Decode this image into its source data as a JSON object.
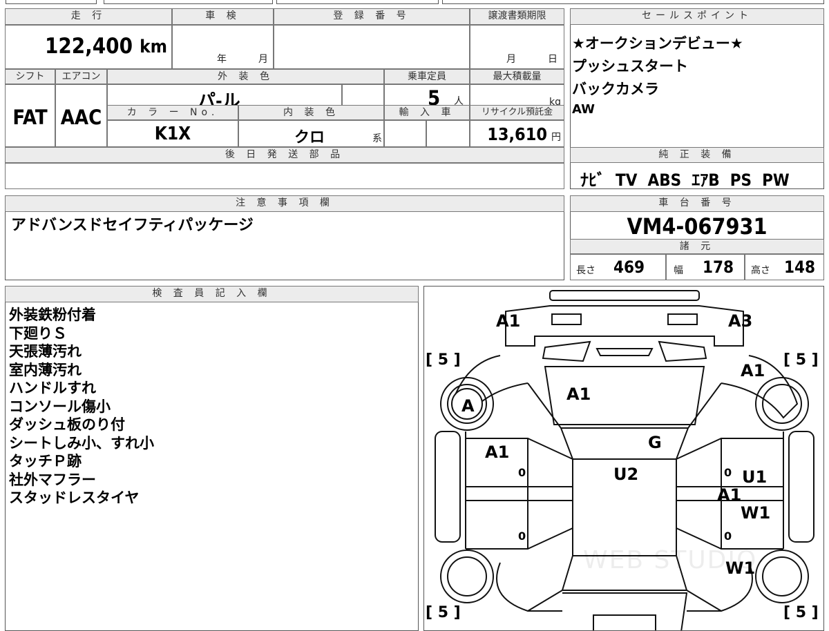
{
  "top_strip": [
    "",
    "",
    "",
    ""
  ],
  "headers": {
    "mileage": "走 行",
    "inspection": "車 検",
    "registration": "登 録 番 号",
    "transfer_deadline": "譲渡書類期限",
    "sales_points": "セールスポイント",
    "shift": "シフト",
    "aircon": "エアコン",
    "exterior_color": "外 装 色",
    "capacity": "乗車定員",
    "max_load": "最大積載量",
    "color_no": "カ ラ ー No.",
    "interior_color": "内 装 色",
    "import": "輸 入 車",
    "recycle": "リサイクル預託金",
    "later_parts": "後 日 発 送 部 品",
    "genuine_equipment": "純 正 装 備",
    "notes": "注 意 事 項 欄",
    "chassis_no": "車 台 番 号",
    "specs": "諸 元",
    "inspector": "検 査 員 記 入 欄"
  },
  "values": {
    "mileage": "122,400",
    "mileage_unit": "km",
    "inspection_year": "年",
    "inspection_month": "月",
    "transfer_month": "月",
    "transfer_day": "日",
    "shift": "FAT",
    "aircon": "AAC",
    "exterior_color": "パ-ル",
    "capacity": "5",
    "capacity_unit": "人",
    "max_load_unit": "kg",
    "color_no": "K1X",
    "interior_color": "クロ",
    "interior_suffix": "系",
    "recycle": "13,610",
    "recycle_unit": "円",
    "genuine_equipment": "ﾅﾋﾞ  TV  ABS  ｴｱB  PS  PW",
    "notes": "アドバンスドセイフティパッケージ",
    "chassis_no": "VM4-067931",
    "length_label": "長さ",
    "length": "469",
    "width_label": "幅",
    "width": "178",
    "height_label": "高さ",
    "height": "148"
  },
  "sales_points": [
    "★オークションデビュー★",
    "プッシュスタート",
    "バックカメラ",
    "AW"
  ],
  "inspector_notes": [
    "外装鉄粉付着",
    "下廻りＳ",
    "天張薄汚れ",
    "室内薄汚れ",
    "ハンドルすれ",
    "コンソール傷小",
    "ダッシュ板のり付",
    "シートしみ小、すれ小",
    "タッチＰ跡",
    "社外マフラー",
    "スタッドレスタイヤ"
  ],
  "diagram": {
    "labels": [
      "A1",
      "A3",
      "A1",
      "A1",
      "A",
      "G",
      "A1",
      "U2",
      "U1",
      "A1",
      "W1",
      "W1"
    ],
    "tire_tl": "[ 5 ]",
    "tire_tr": "[ 5 ]",
    "tire_bl": "[ 5 ]",
    "tire_br": "[ 5 ]",
    "zeros": [
      "0",
      "0",
      "0",
      "0"
    ],
    "watermark": "WEB STUDIO"
  }
}
